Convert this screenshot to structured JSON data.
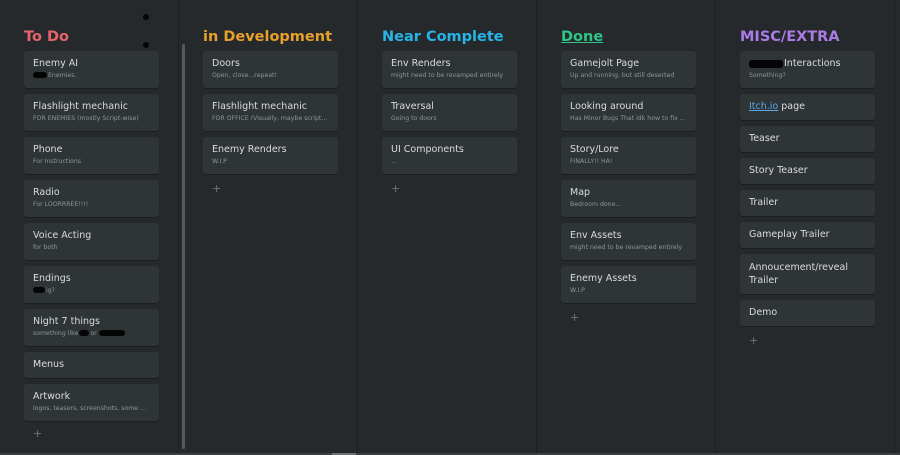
{
  "colors": {
    "background": "#25292c",
    "card": "#2f3437",
    "todo": "#e8656b",
    "dev": "#e8a02a",
    "near": "#27b5e8",
    "done": "#30c48a",
    "misc": "#a97ce6",
    "link": "#5aa6e6"
  },
  "columns": [
    {
      "title": "To Do",
      "cards": [
        {
          "title": "Enemy AI",
          "desc": "Enemies."
        },
        {
          "title": "Flashlight mechanic",
          "desc": "FOR ENEMIES (mostly Script-wise)"
        },
        {
          "title": "Phone",
          "desc": "For Instructions"
        },
        {
          "title": "Radio",
          "desc": "For LOORRREE!!!!"
        },
        {
          "title": "Voice Acting",
          "desc": "for both"
        },
        {
          "title": "Endings",
          "desc": "ig?"
        },
        {
          "title": "Night 7 things",
          "desc_pre": "something like",
          "desc_mid": "or"
        },
        {
          "title": "Menus"
        },
        {
          "title": "Artwork",
          "desc": "logos, teasers, screenshots, some art?"
        }
      ],
      "add_label": "+"
    },
    {
      "title": "in Development",
      "cards": [
        {
          "title": "Doors",
          "desc": "Open, close...repeat!"
        },
        {
          "title": "Flashlight mechanic",
          "desc": "FOR OFFICE (Visually, maybe scripts?)"
        },
        {
          "title": "Enemy Renders",
          "desc": "W.I.P"
        }
      ],
      "add_label": "+"
    },
    {
      "title": "Near Complete",
      "cards": [
        {
          "title": "Env Renders",
          "desc": "might need to be revamped entirely"
        },
        {
          "title": "Traversal",
          "desc": "Going to doors"
        },
        {
          "title": "UI Components",
          "desc": "..."
        }
      ],
      "add_label": "+"
    },
    {
      "title": "Done",
      "cards": [
        {
          "title": "Gamejolt Page",
          "desc": "Up and running, but still deserted"
        },
        {
          "title": "Looking around",
          "desc": "Has Minor Bugs That idk how to fix ..."
        },
        {
          "title": "Story/Lore",
          "desc": "FINALLY!! HA!"
        },
        {
          "title": "Map",
          "desc": "Bedroom done..."
        },
        {
          "title": "Env Assets",
          "desc": "might need to be revamped entirely"
        },
        {
          "title": "Enemy Assets",
          "desc": "W.I.P"
        }
      ],
      "add_label": "+"
    },
    {
      "title": "MISC/EXTRA",
      "cards": [
        {
          "title": "Interactions",
          "desc": "Something?"
        },
        {
          "title_link": "Itch.io",
          "title_rest": " page"
        },
        {
          "title": "Teaser"
        },
        {
          "title": "Story Teaser"
        },
        {
          "title": "Trailer"
        },
        {
          "title": "Gameplay Trailer"
        },
        {
          "title": "Annoucement/reveal Trailer"
        },
        {
          "title": "Demo"
        }
      ],
      "add_label": "+"
    }
  ]
}
